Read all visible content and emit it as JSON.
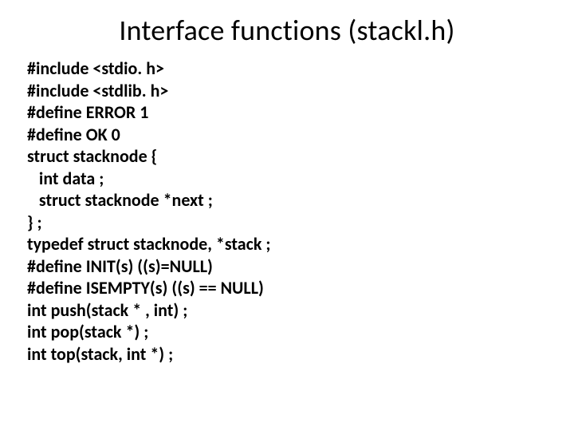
{
  "title": "Interface functions (stackl.h)",
  "code_lines": [
    "#include <stdio. h>",
    "#include <stdlib. h>",
    "#define ERROR 1",
    "#define OK 0",
    "struct stacknode {",
    "   int data ;",
    "   struct stacknode *next ;",
    "} ;",
    "typedef struct stacknode, *stack ;",
    "#define INIT(s) ((s)=NULL)",
    "#define ISEMPTY(s) ((s) == NULL)",
    "int push(stack * , int) ;",
    "int pop(stack *) ;",
    "int top(stack, int *) ;"
  ]
}
